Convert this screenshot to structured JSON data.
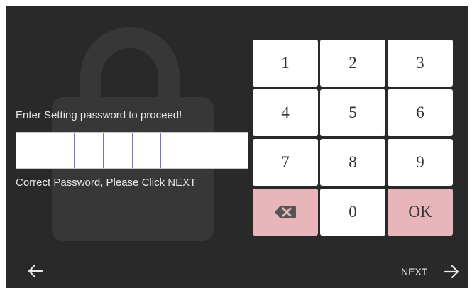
{
  "colors": {
    "panel_bg": "#292929",
    "lock_watermark": "#373737",
    "key_bg": "#ffffff",
    "key_accent": "#e8b6ba",
    "text": "#e8e8e8"
  },
  "password": {
    "prompt": "Enter Setting password to proceed!",
    "status": "Correct Password, Please Click NEXT",
    "cells": [
      "",
      "",
      "",
      "",
      "",
      "",
      "",
      ""
    ]
  },
  "keypad": {
    "k1": "1",
    "k2": "2",
    "k3": "3",
    "k4": "4",
    "k5": "5",
    "k6": "6",
    "k7": "7",
    "k8": "8",
    "k9": "9",
    "k0": "0",
    "ok": "OK",
    "backspace_icon": "backspace-icon"
  },
  "footer": {
    "back_icon": "arrow-left-icon",
    "next_label": "NEXT",
    "next_icon": "arrow-right-icon"
  }
}
